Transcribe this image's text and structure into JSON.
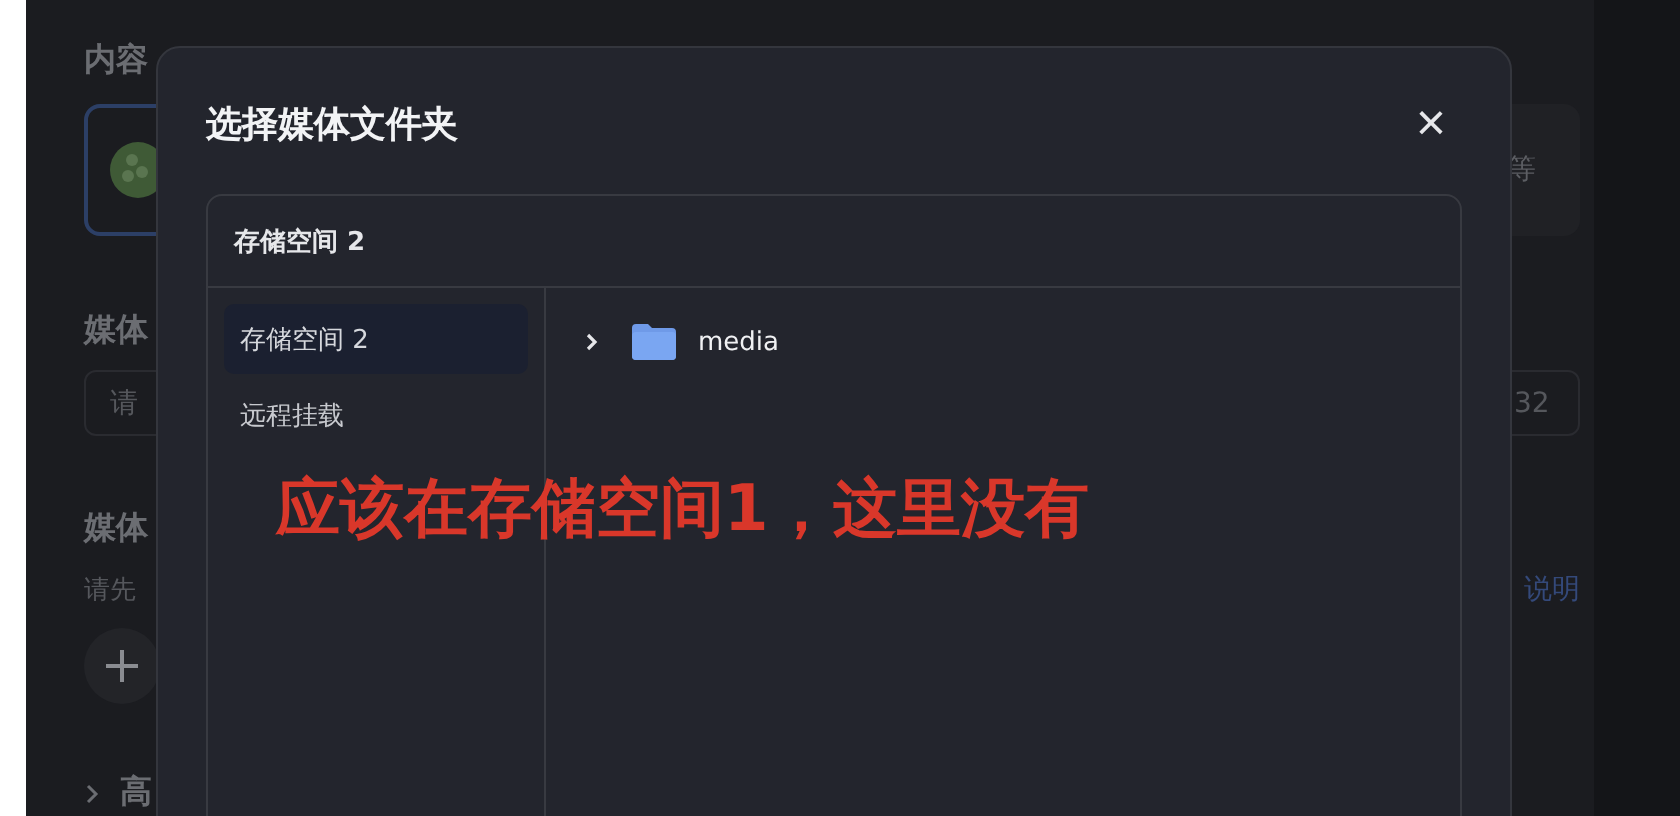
{
  "background_page": {
    "section_1_label": "内容",
    "card_right_text": "等",
    "section_2_label": "媒体",
    "field_left_placeholder": "请",
    "field_right_value": "32",
    "section_3_label": "媒体",
    "hint_text": "请先",
    "link_text": "说明",
    "advanced_label": "高"
  },
  "dialog": {
    "title": "选择媒体文件夹",
    "close": "×",
    "panel_header": "存储空间 2",
    "storages": [
      {
        "label": "存储空间 2",
        "selected": true
      },
      {
        "label": "远程挂载",
        "selected": false
      }
    ],
    "folders": [
      {
        "name": "media",
        "expanded": false
      }
    ]
  },
  "annotation": "应该在存储空间1，这里没有"
}
